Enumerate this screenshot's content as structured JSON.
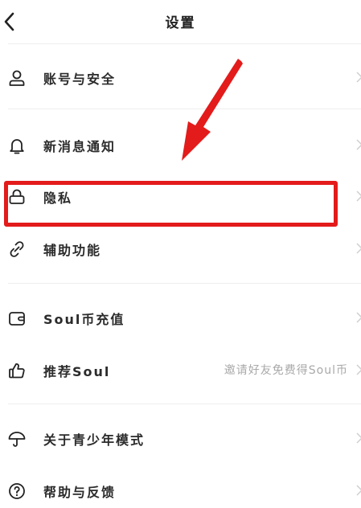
{
  "header": {
    "title": "设置"
  },
  "items": [
    {
      "label": "账号与安全",
      "icon": "user-icon"
    },
    {
      "label": "新消息通知",
      "icon": "bell-icon"
    },
    {
      "label": "隐私",
      "icon": "lock-icon"
    },
    {
      "label": "辅助功能",
      "icon": "link-icon"
    },
    {
      "label": "Soul币充值",
      "icon": "wallet-icon"
    },
    {
      "label": "推荐Soul",
      "value": "邀请好友免费得Soul币",
      "icon": "thumbs-up-icon"
    },
    {
      "label": "关于青少年模式",
      "icon": "umbrella-icon"
    },
    {
      "label": "帮助与反馈",
      "icon": "help-icon"
    }
  ],
  "annotation": {
    "highlight_color": "#e31b1b",
    "highlighted_item": "隐私"
  }
}
